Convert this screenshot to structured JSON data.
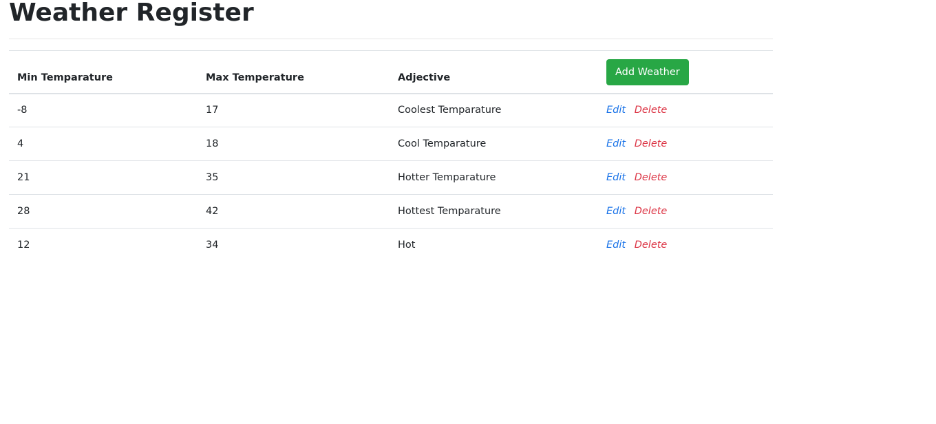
{
  "page": {
    "title": "Weather Register"
  },
  "table": {
    "headers": {
      "min": "Min Temparature",
      "max": "Max Temperature",
      "adjective": "Adjective"
    },
    "add_button_label": "Add Weather",
    "edit_label": "Edit",
    "delete_label": "Delete",
    "rows": [
      {
        "min": "-8",
        "max": "17",
        "adjective": "Coolest Temparature"
      },
      {
        "min": "4",
        "max": "18",
        "adjective": "Cool Temparature"
      },
      {
        "min": "21",
        "max": "35",
        "adjective": "Hotter Temparature"
      },
      {
        "min": "28",
        "max": "42",
        "adjective": "Hottest Temparature"
      },
      {
        "min": "12",
        "max": "34",
        "adjective": "Hot"
      }
    ]
  },
  "colors": {
    "add_button": "#28a745",
    "edit_link": "#1a73e8",
    "delete_link": "#dc3545"
  }
}
